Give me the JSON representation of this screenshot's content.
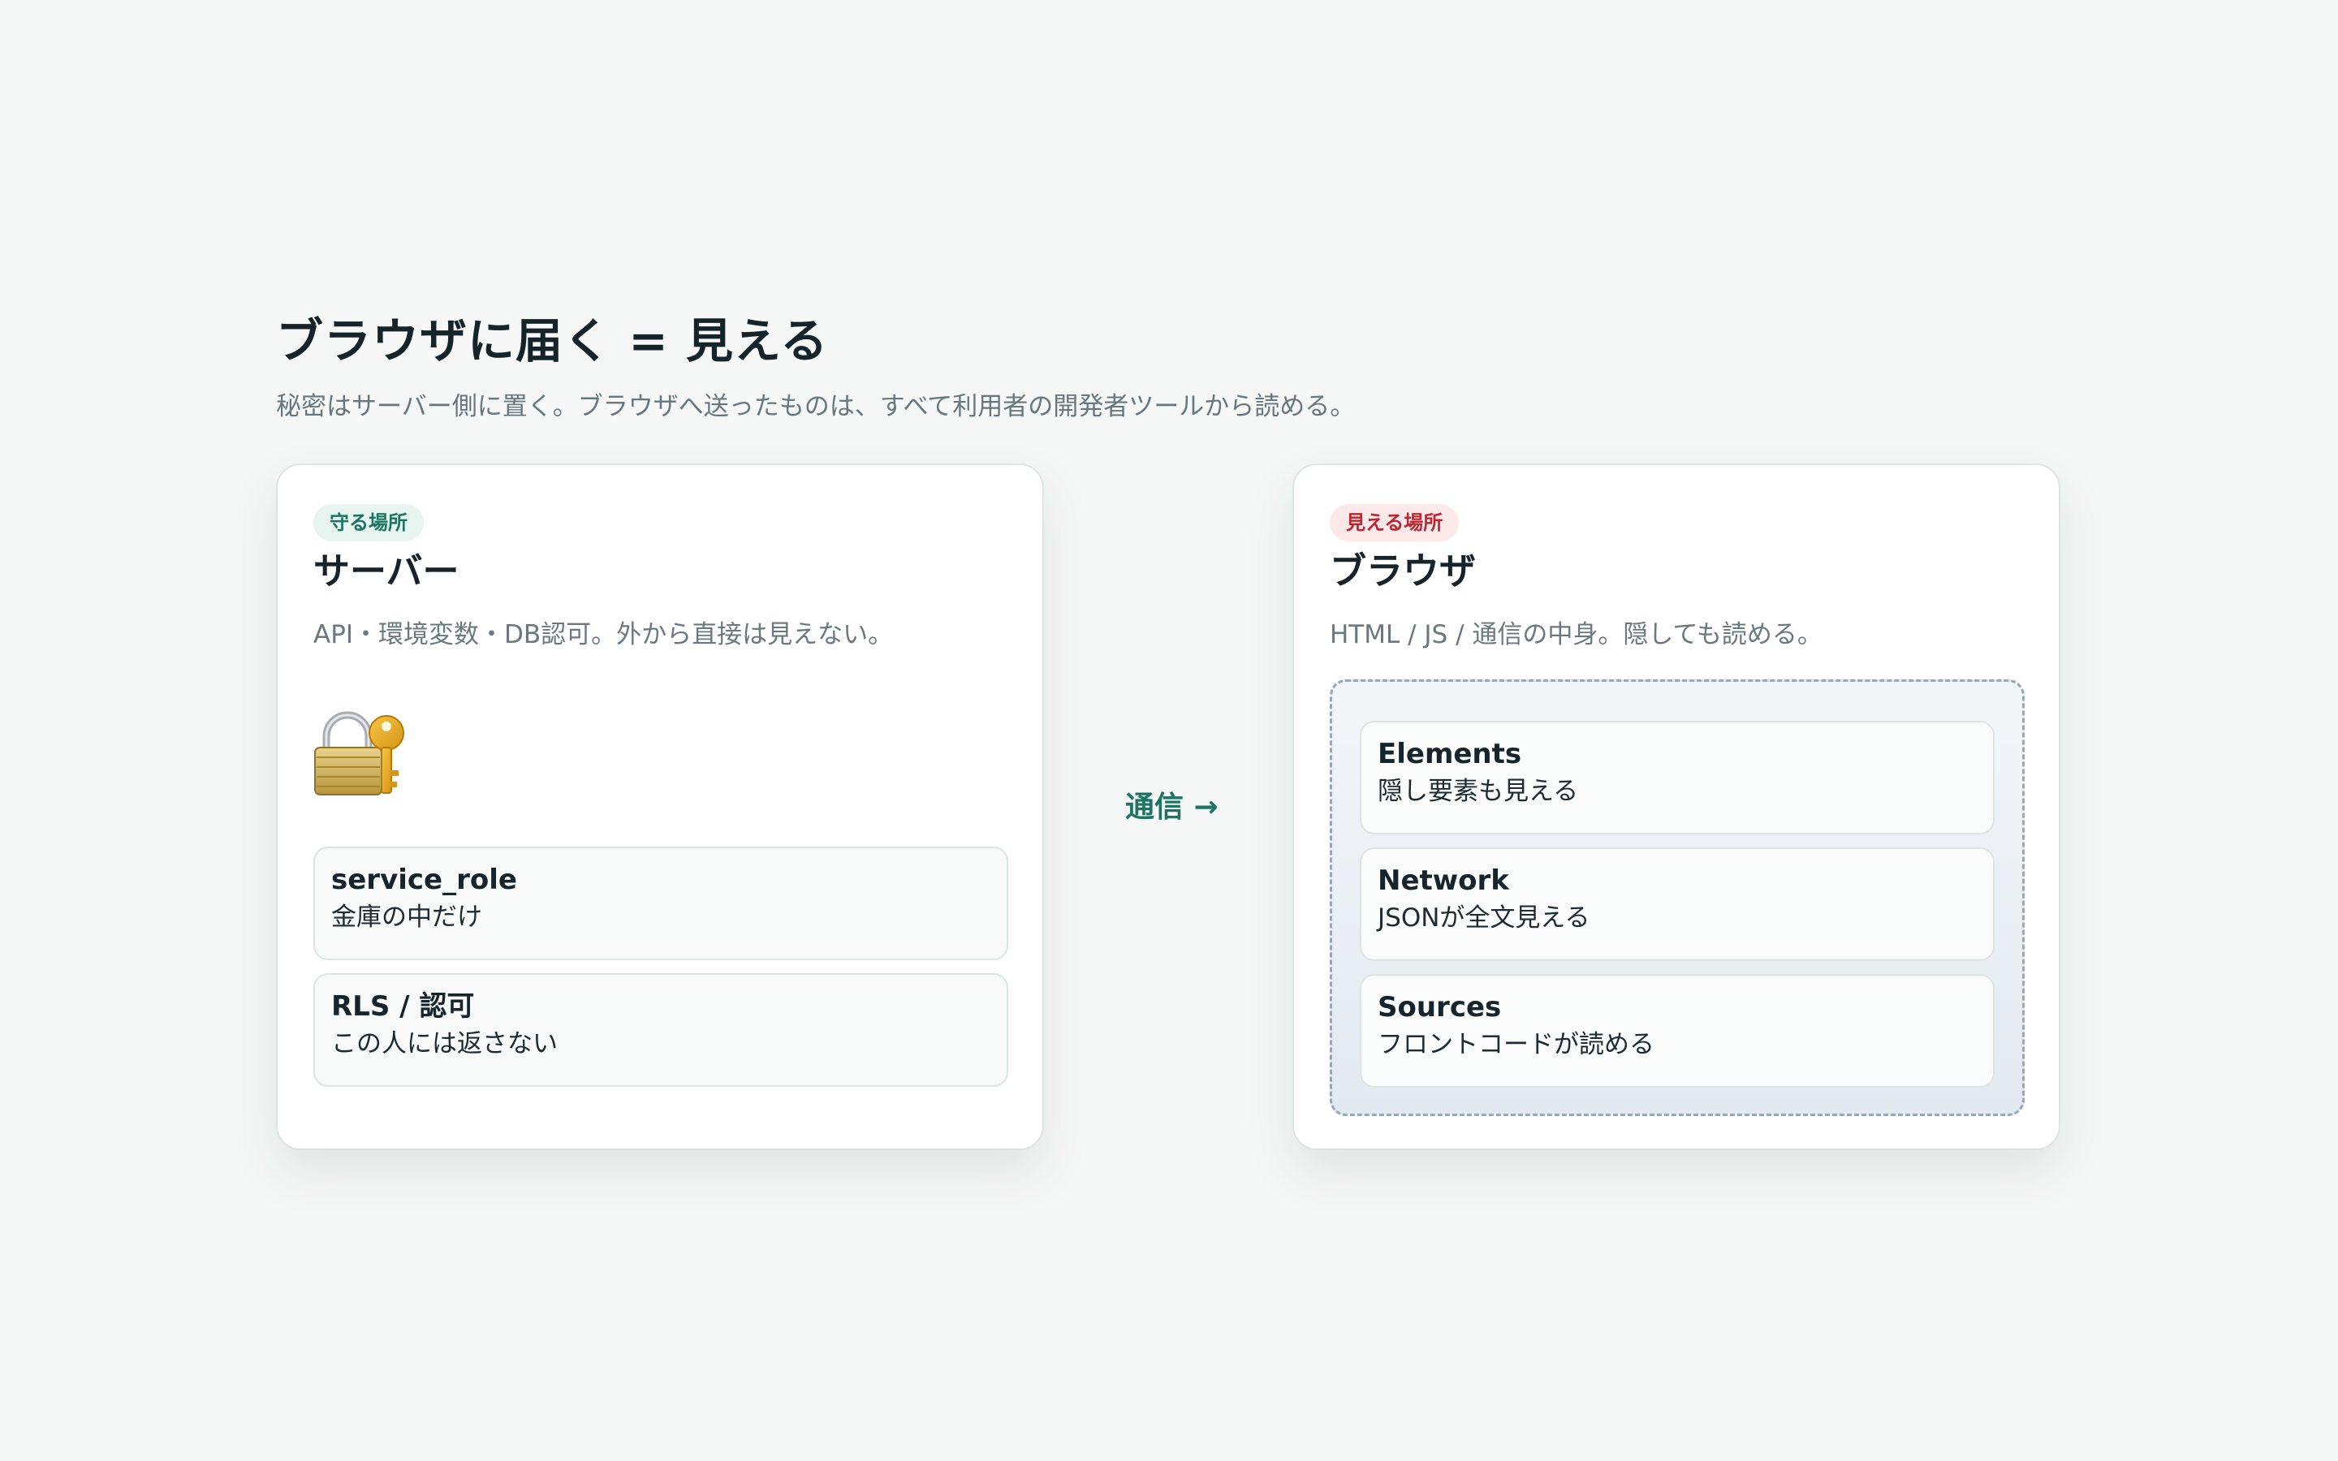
{
  "header": {
    "title": "ブラウザに届く = 見える",
    "subtitle": "秘密はサーバー側に置く。ブラウザへ送ったものは、すべて利用者の開発者ツールから読める。"
  },
  "server_card": {
    "badge": "守る場所",
    "title": "サーバー",
    "description": "API・環境変数・DB認可。外から直接は見えない。",
    "icon": "lock-with-key-icon",
    "items": [
      {
        "title": "service_role",
        "subtitle": "金庫の中だけ"
      },
      {
        "title": "RLS / 認可",
        "subtitle": "この人には返さない"
      }
    ]
  },
  "flow": {
    "label": "通信 →"
  },
  "browser_card": {
    "badge": "見える場所",
    "title": "ブラウザ",
    "description": "HTML / JS / 通信の中身。隠しても読める。",
    "items": [
      {
        "title": "Elements",
        "subtitle": "隠し要素も見える"
      },
      {
        "title": "Network",
        "subtitle": "JSONが全文見える"
      },
      {
        "title": "Sources",
        "subtitle": "フロントコードが読める"
      }
    ]
  },
  "colors": {
    "background": "#f5f8f7",
    "accent_green": "#1c7563",
    "accent_red": "#c0242f",
    "text_dark": "#162329",
    "text_muted": "#68767e"
  }
}
